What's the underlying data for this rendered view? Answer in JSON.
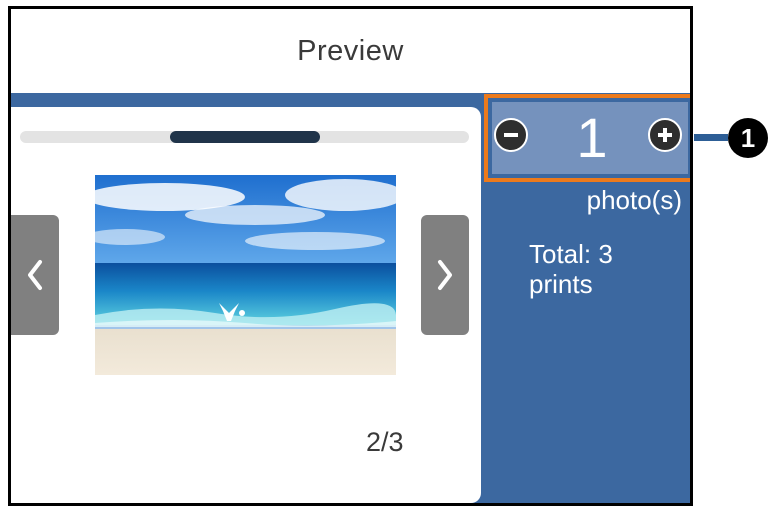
{
  "header": {
    "title": "Preview"
  },
  "preview": {
    "page_indicator": "2/3",
    "photo_icon": "beach-photo",
    "prev_icon": "chevron-left-icon",
    "next_icon": "chevron-right-icon"
  },
  "copies": {
    "value": "1",
    "unit_label": "photo(s)",
    "total_label": "Total: 3\nprints",
    "minus_icon": "minus-circle-icon",
    "plus_icon": "plus-circle-icon"
  },
  "callout": {
    "number": "1"
  },
  "colors": {
    "panel_blue": "#3c68a0",
    "stepper_blue": "#7592bd",
    "highlight_orange": "#ec7a1c"
  }
}
